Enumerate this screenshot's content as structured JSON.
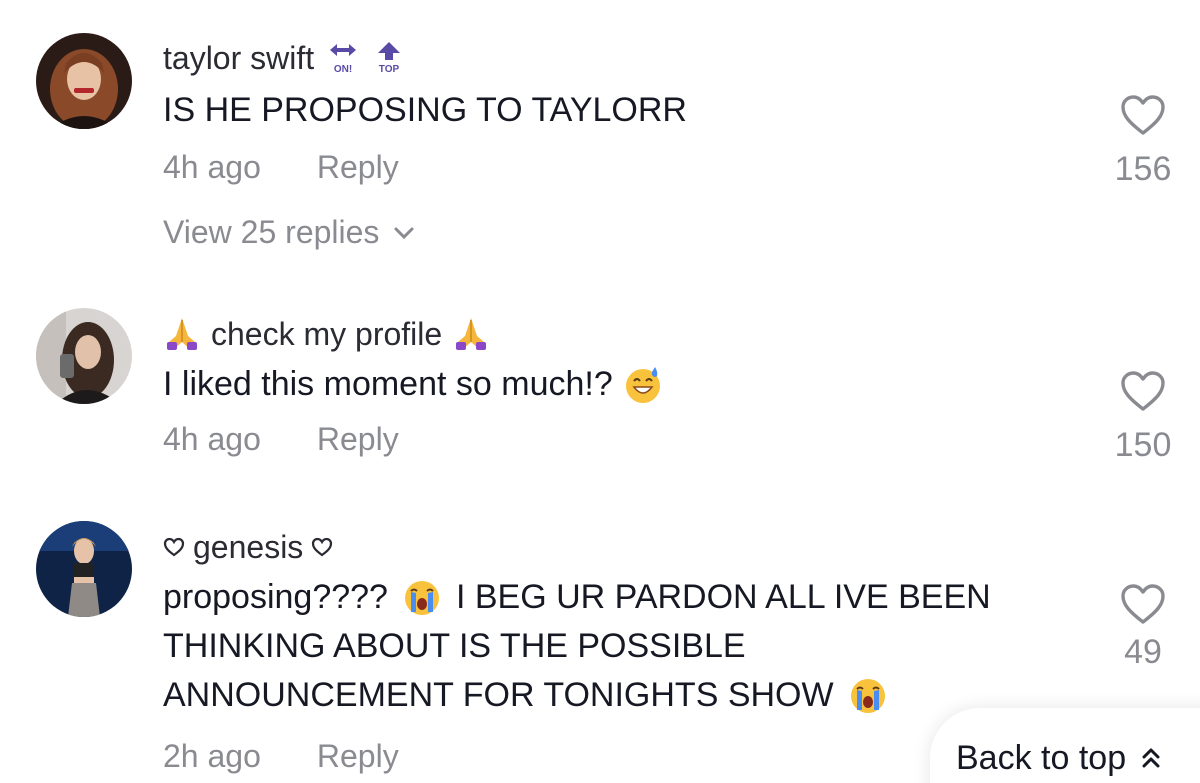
{
  "comments": [
    {
      "username": "taylor swift",
      "badge_on_label": "ON!",
      "badge_top_label": "TOP",
      "text": "IS HE PROPOSING TO TAYLORR",
      "time": "4h ago",
      "reply_label": "Reply",
      "likes": "156",
      "view_replies": "View 25 replies"
    },
    {
      "username": "check my profile",
      "text": "I liked this moment so much!?",
      "time": "4h ago",
      "reply_label": "Reply",
      "likes": "150"
    },
    {
      "username": "genesis",
      "text_part1": "proposing????",
      "text_part2": "I BEG UR PARDON ALL IVE BEEN",
      "text_line2": "THINKING ABOUT IS THE POSSIBLE",
      "text_line3": "ANNOUNCEMENT FOR TONIGHTS SHOW",
      "time": "2h ago",
      "reply_label": "Reply",
      "likes": "49"
    }
  ],
  "back_to_top": "Back to top",
  "colors": {
    "text": "#161823",
    "secondary": "#8a8b91",
    "badge": "#5a4aa8"
  }
}
